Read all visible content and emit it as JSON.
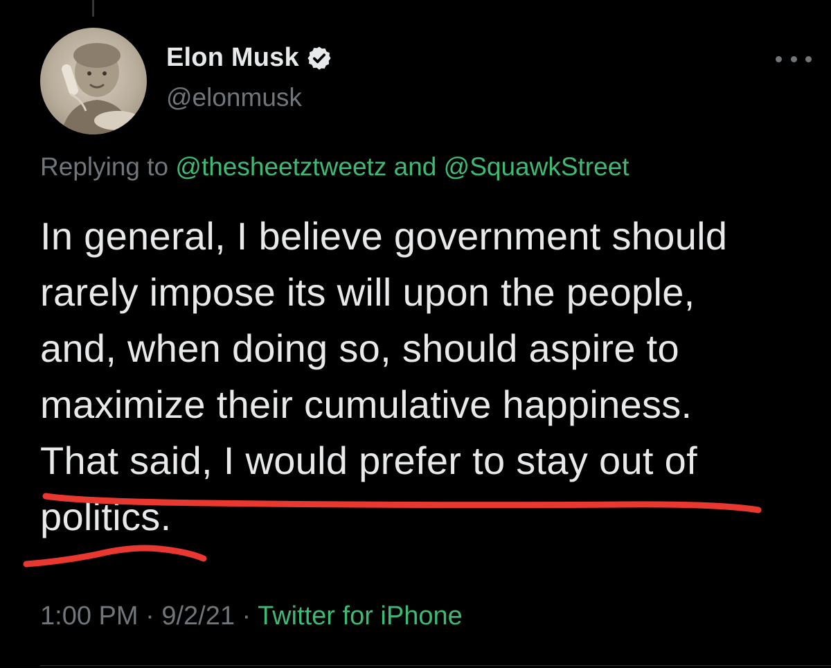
{
  "author": {
    "display_name": "Elon Musk",
    "handle": "@elonmusk",
    "verified_icon": "verified-badge-icon"
  },
  "reply_context": {
    "prefix": "Replying to",
    "mention_1": "@thesheetztweetz",
    "conjunction": "and",
    "mention_2": "@SquawkStreet"
  },
  "tweet": {
    "lines": [
      "In general, I believe government should",
      "rarely impose its will upon the people,",
      "and, when doing so, should aspire to",
      "maximize their cumulative happiness.",
      "That said, I would prefer to stay out of",
      "politics."
    ]
  },
  "meta": {
    "time": "1:00 PM",
    "separator": "·",
    "date": "9/2/21",
    "source": "Twitter for iPhone"
  },
  "more_icon": "more-options-icon",
  "colors": {
    "background": "#000000",
    "text": "#e7e9ea",
    "secondary": "#71767b",
    "link": "#3fba75",
    "annotation": "#e8382f"
  }
}
